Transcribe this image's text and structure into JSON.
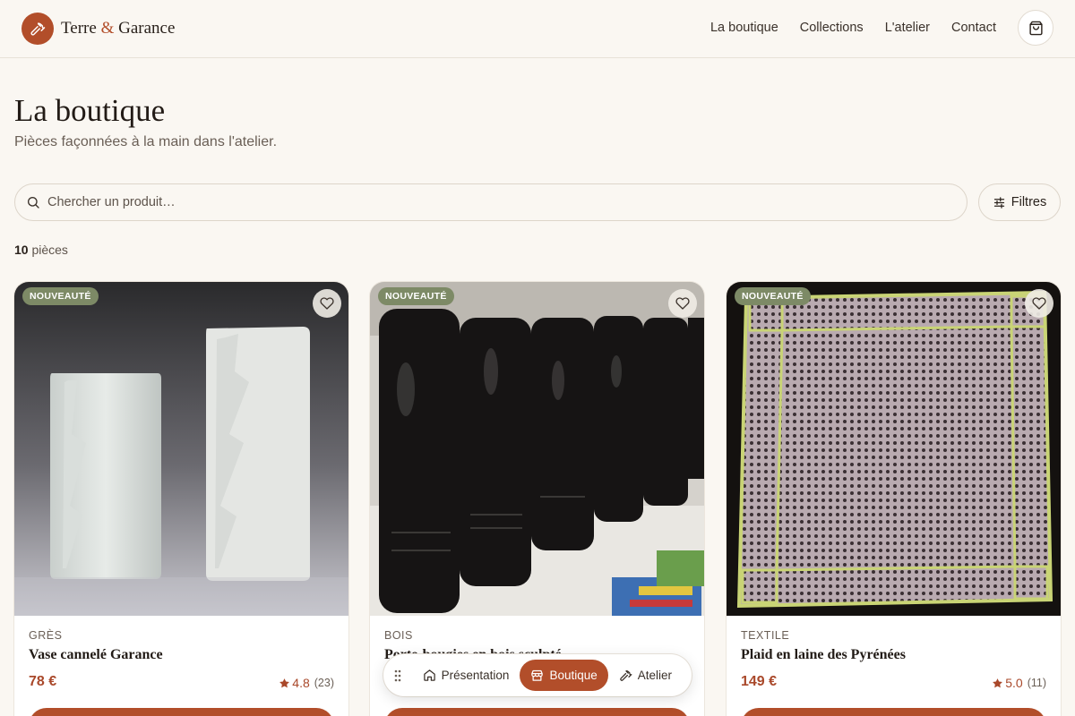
{
  "brand": {
    "name_1": "Terre ",
    "amp": "&",
    "name_2": " Garance",
    "logo_icon": "hammer-icon"
  },
  "nav": {
    "links": [
      "La boutique",
      "Collections",
      "L'atelier",
      "Contact"
    ],
    "cart_icon": "shopping-bag-icon"
  },
  "page": {
    "title": "La boutique",
    "subtitle": "Pièces façonnées à la main dans l'atelier."
  },
  "search": {
    "placeholder": "Chercher un produit…",
    "value": ""
  },
  "filters": {
    "label": "Filtres"
  },
  "results": {
    "count": "10",
    "unit": " pièces"
  },
  "products": [
    {
      "badge": "NOUVEAUTÉ",
      "category": "GRÈS",
      "name": "Vase cannelé Garance",
      "price": "78 €",
      "rating": "4.8",
      "reviews": "(23)"
    },
    {
      "badge": "NOUVEAUTÉ",
      "category": "BOIS",
      "name": "Porte-bougies en bois sculpté",
      "price": "",
      "rating": "",
      "reviews": ""
    },
    {
      "badge": "NOUVEAUTÉ",
      "category": "TEXTILE",
      "name": "Plaid en laine des Pyrénées",
      "price": "149 €",
      "rating": "5.0",
      "reviews": "(11)"
    }
  ],
  "dock": {
    "items": [
      {
        "label": "Présentation",
        "icon": "home-icon"
      },
      {
        "label": "Boutique",
        "icon": "store-icon"
      },
      {
        "label": "Atelier",
        "icon": "hammer-icon"
      }
    ]
  },
  "colors": {
    "accent": "#b24e2a",
    "badge": "#7d8a66",
    "background": "#faf7f2"
  }
}
